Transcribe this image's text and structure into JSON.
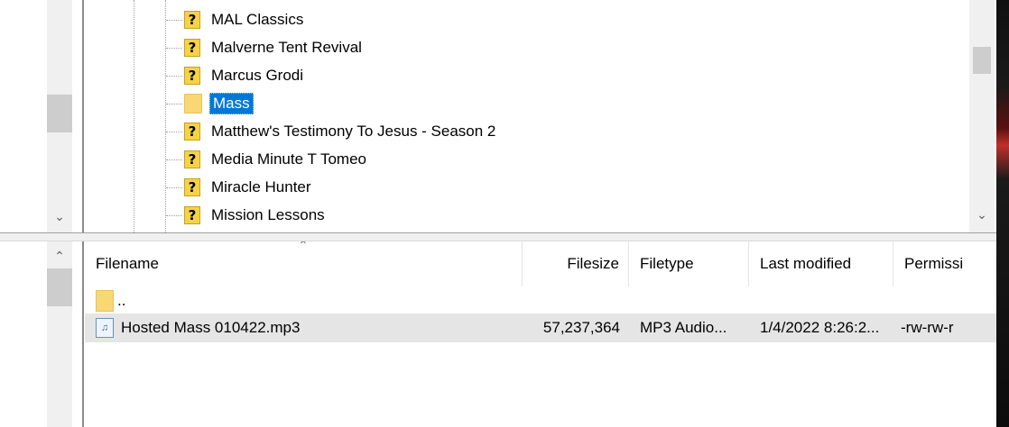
{
  "tree": {
    "items": [
      {
        "label": "MAL Classics",
        "icon": "question-icon"
      },
      {
        "label": "Malverne Tent Revival",
        "icon": "question-icon"
      },
      {
        "label": "Marcus Grodi",
        "icon": "question-icon"
      },
      {
        "label": "Mass",
        "icon": "folder-icon",
        "selected": true
      },
      {
        "label": "Matthew's Testimony To Jesus - Season 2",
        "icon": "question-icon"
      },
      {
        "label": "Media Minute T Tomeo",
        "icon": "question-icon"
      },
      {
        "label": "Miracle Hunter",
        "icon": "question-icon"
      },
      {
        "label": "Mission Lessons",
        "icon": "question-icon"
      }
    ],
    "question_glyph": "?"
  },
  "filelist": {
    "columns": {
      "filename": "Filename",
      "filesize": "Filesize",
      "filetype": "Filetype",
      "lastmod": "Last modified",
      "permissions": "Permissi"
    },
    "parent_row": {
      "name": ".."
    },
    "rows": [
      {
        "name": "Hosted Mass 010422.mp3",
        "size": "57,237,364",
        "type": "MP3 Audio...",
        "modified": "1/4/2022 8:26:2...",
        "permissions": "-rw-rw-r"
      }
    ]
  },
  "colors": {
    "selection": "#0078d7",
    "folder": "#f8d775",
    "question_icon": "#f4d34a",
    "row_highlight": "#e5e5e5"
  }
}
